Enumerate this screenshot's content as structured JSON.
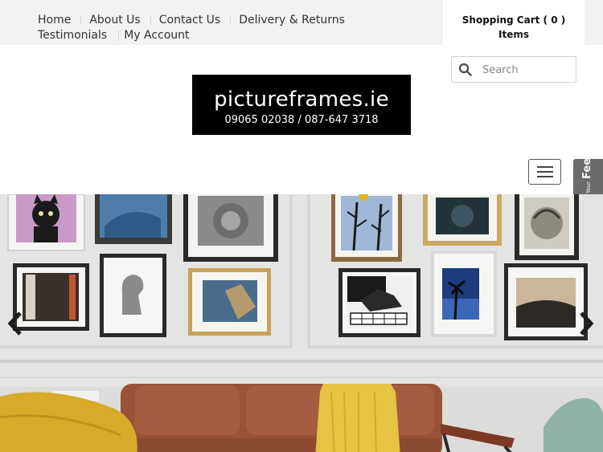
{
  "topnav": {
    "items": [
      "Home",
      "About Us",
      "Contact Us",
      "Delivery & Returns",
      "Testimonials",
      "My Account"
    ]
  },
  "cart": {
    "line1": "Shopping Cart ( 0 )",
    "line2": "Items"
  },
  "search": {
    "placeholder": "Search",
    "icon": "search-icon"
  },
  "logo": {
    "name": "pictureframes.ie",
    "phone": "09065 02038 / 087-647 3718"
  },
  "menu_icon": "hamburger-menu-icon",
  "feedback": {
    "line1": "Give Us Your",
    "line2": "Feedback",
    "buttons": [
      "+",
      "–"
    ]
  },
  "hero": {
    "arrows": [
      "chevron-left-icon",
      "chevron-right-icon"
    ]
  },
  "colors": {
    "topbar_bg": "#f2f2f2",
    "text": "#333333",
    "logo_bg": "#000000",
    "feedback_bg": "#6b6b6b",
    "wall": "#e4e4e2",
    "sofa": "#9a5238",
    "throw": "#e6c342",
    "chair": "#d8aa2a"
  }
}
